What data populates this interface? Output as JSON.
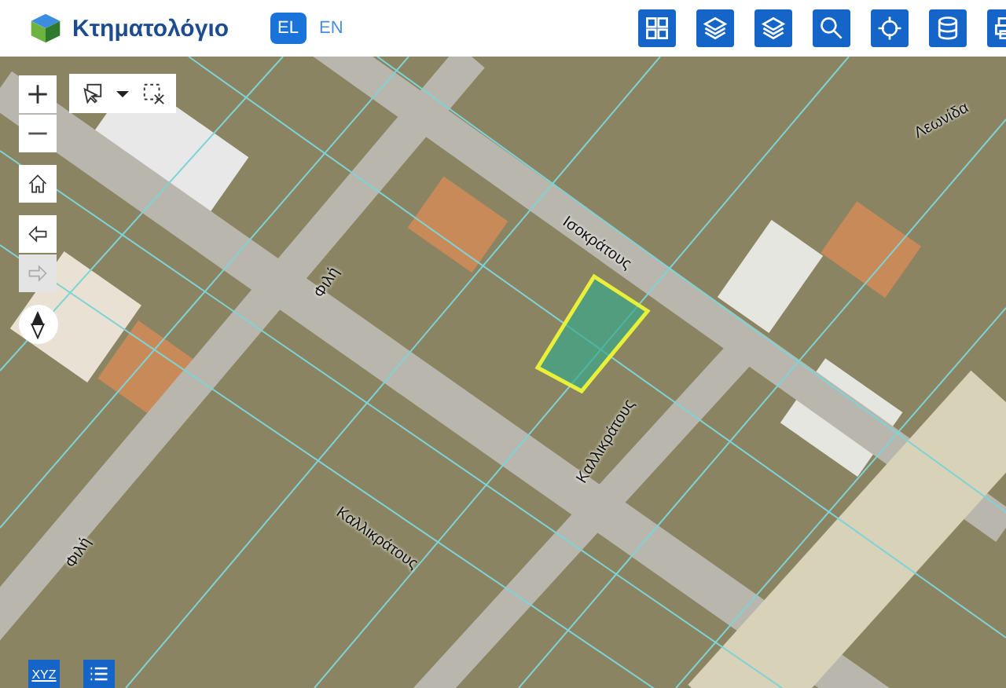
{
  "header": {
    "title": "Κτηματολόγιο",
    "languages": [
      {
        "label": "EL",
        "selected": true
      },
      {
        "label": "EN",
        "selected": false
      }
    ]
  },
  "map_controls": {
    "back_disabled": false,
    "forward_disabled": true
  },
  "street_labels": [
    {
      "text": "Ισοκράτους"
    },
    {
      "text": "Φιλή"
    },
    {
      "text": "Καλλικράτους"
    },
    {
      "text": "Καλλικράτους"
    },
    {
      "text": "Φιλή"
    },
    {
      "text": "Λεωνίδα"
    }
  ],
  "bottom_tools": {
    "coordinates_label": "XYZ"
  }
}
